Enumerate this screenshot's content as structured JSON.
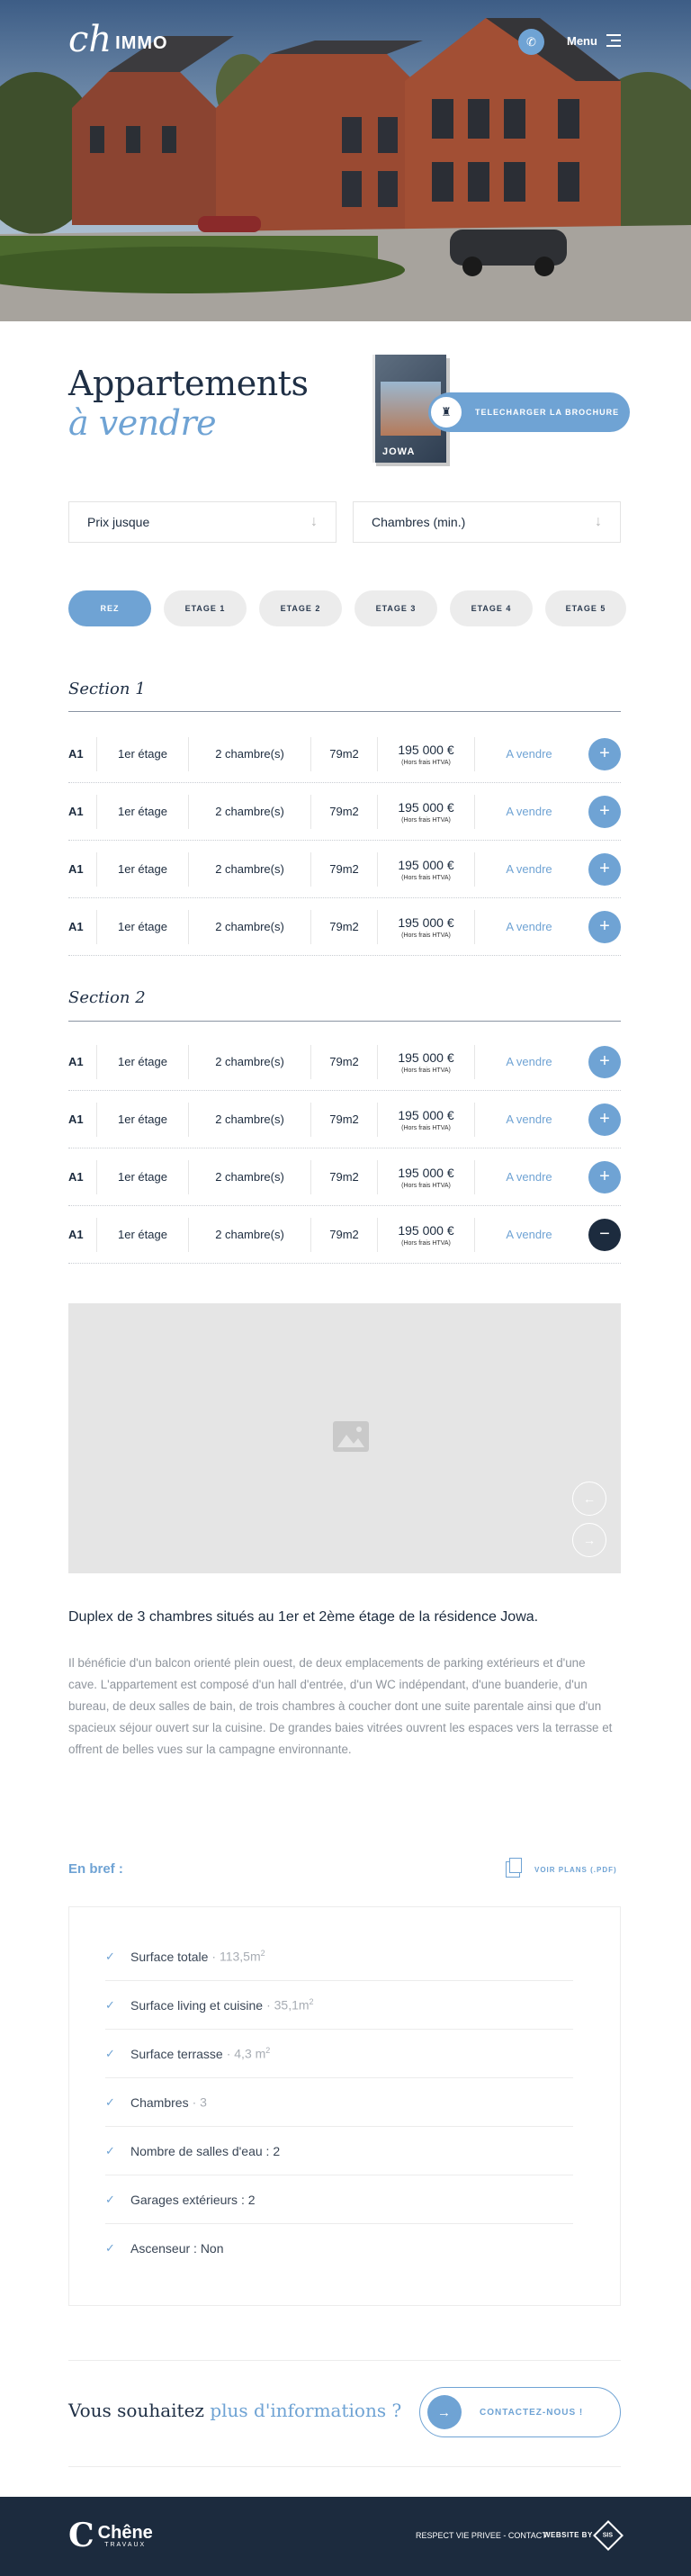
{
  "header": {
    "logo_mark": "ch",
    "logo_text": "IMMO",
    "menu_label": "Menu"
  },
  "title": {
    "line1": "Appartements",
    "line2": "à vendre"
  },
  "brochure": {
    "book_title": "JOWA",
    "button_label": "TELECHARGER LA BROCHURE"
  },
  "filters": {
    "price": "Prix jusque",
    "rooms": "Chambres (min.)"
  },
  "tabs": [
    "REZ",
    "ETAGE 1",
    "ETAGE 2",
    "ETAGE 3",
    "ETAGE 4",
    "ETAGE 5"
  ],
  "sections": [
    {
      "title": "Section 1",
      "rows": [
        {
          "id": "A1",
          "floor": "1er étage",
          "rooms": "2 chambre(s)",
          "area": "79m2",
          "price": "195 000 €",
          "price_note": "(Hors frais HTVA)",
          "status": "A vendre"
        },
        {
          "id": "A1",
          "floor": "1er étage",
          "rooms": "2 chambre(s)",
          "area": "79m2",
          "price": "195 000 €",
          "price_note": "(Hors frais HTVA)",
          "status": "A vendre"
        },
        {
          "id": "A1",
          "floor": "1er étage",
          "rooms": "2 chambre(s)",
          "area": "79m2",
          "price": "195 000 €",
          "price_note": "(Hors frais HTVA)",
          "status": "A vendre"
        },
        {
          "id": "A1",
          "floor": "1er étage",
          "rooms": "2 chambre(s)",
          "area": "79m2",
          "price": "195 000 €",
          "price_note": "(Hors frais HTVA)",
          "status": "A vendre"
        }
      ]
    },
    {
      "title": "Section 2",
      "rows": [
        {
          "id": "A1",
          "floor": "1er étage",
          "rooms": "2 chambre(s)",
          "area": "79m2",
          "price": "195 000 €",
          "price_note": "(Hors frais HTVA)",
          "status": "A vendre"
        },
        {
          "id": "A1",
          "floor": "1er étage",
          "rooms": "2 chambre(s)",
          "area": "79m2",
          "price": "195 000 €",
          "price_note": "(Hors frais HTVA)",
          "status": "A vendre"
        },
        {
          "id": "A1",
          "floor": "1er étage",
          "rooms": "2 chambre(s)",
          "area": "79m2",
          "price": "195 000 €",
          "price_note": "(Hors frais HTVA)",
          "status": "A vendre"
        },
        {
          "id": "A1",
          "floor": "1er étage",
          "rooms": "2 chambre(s)",
          "area": "79m2",
          "price": "195 000 €",
          "price_note": "(Hors frais HTVA)",
          "status": "A vendre"
        }
      ]
    }
  ],
  "detail": {
    "title": "Duplex de 3 chambres situés au 1er et 2ème étage de la résidence Jowa.",
    "description": "Il bénéficie d'un balcon orienté plein ouest, de deux emplacements de parking extérieurs et d'une cave. L'appartement est composé d'un hall d'entrée, d'un WC indépendant, d'une buanderie, d'un bureau, de deux salles de bain, de trois chambres à coucher dont une suite parentale ainsi que d'un spacieux séjour ouvert sur la cuisine. De grandes baies vitrées ouvrent les espaces vers la terrasse et offrent de belles vues sur la campagne environnante.",
    "bref_label": "En bref :",
    "plans_label": "VOIR PLANS (.PDF)",
    "features": [
      {
        "label": "Surface totale",
        "value": "113,5m",
        "sup": "2"
      },
      {
        "label": "Surface living et cuisine",
        "value": "35,1m",
        "sup": "2"
      },
      {
        "label": "Surface terrasse",
        "value": "4,3 m",
        "sup": "2"
      },
      {
        "label": "Chambres",
        "value": "3",
        "sup": ""
      },
      {
        "label": "Nombre de salles d'eau : 2",
        "value": "",
        "sup": ""
      },
      {
        "label": "Garages extérieurs : 2",
        "value": "",
        "sup": ""
      },
      {
        "label": "Ascenseur : Non",
        "value": "",
        "sup": ""
      }
    ]
  },
  "contact": {
    "text1": "Vous souhaitez",
    "text2": "plus d'informations ?",
    "button": "CONTACTEZ-NOUS !"
  },
  "footer": {
    "brand": "Chêne",
    "brand_sub": "TRAVAUX",
    "links": "RESPECT VIE PRIVEE - CONTACT",
    "website_by": "WEBSITE BY",
    "badge": "SIS"
  },
  "colors": {
    "accent": "#6fa3d4",
    "navy": "#1c2b3e",
    "text_muted": "#8f959d"
  }
}
